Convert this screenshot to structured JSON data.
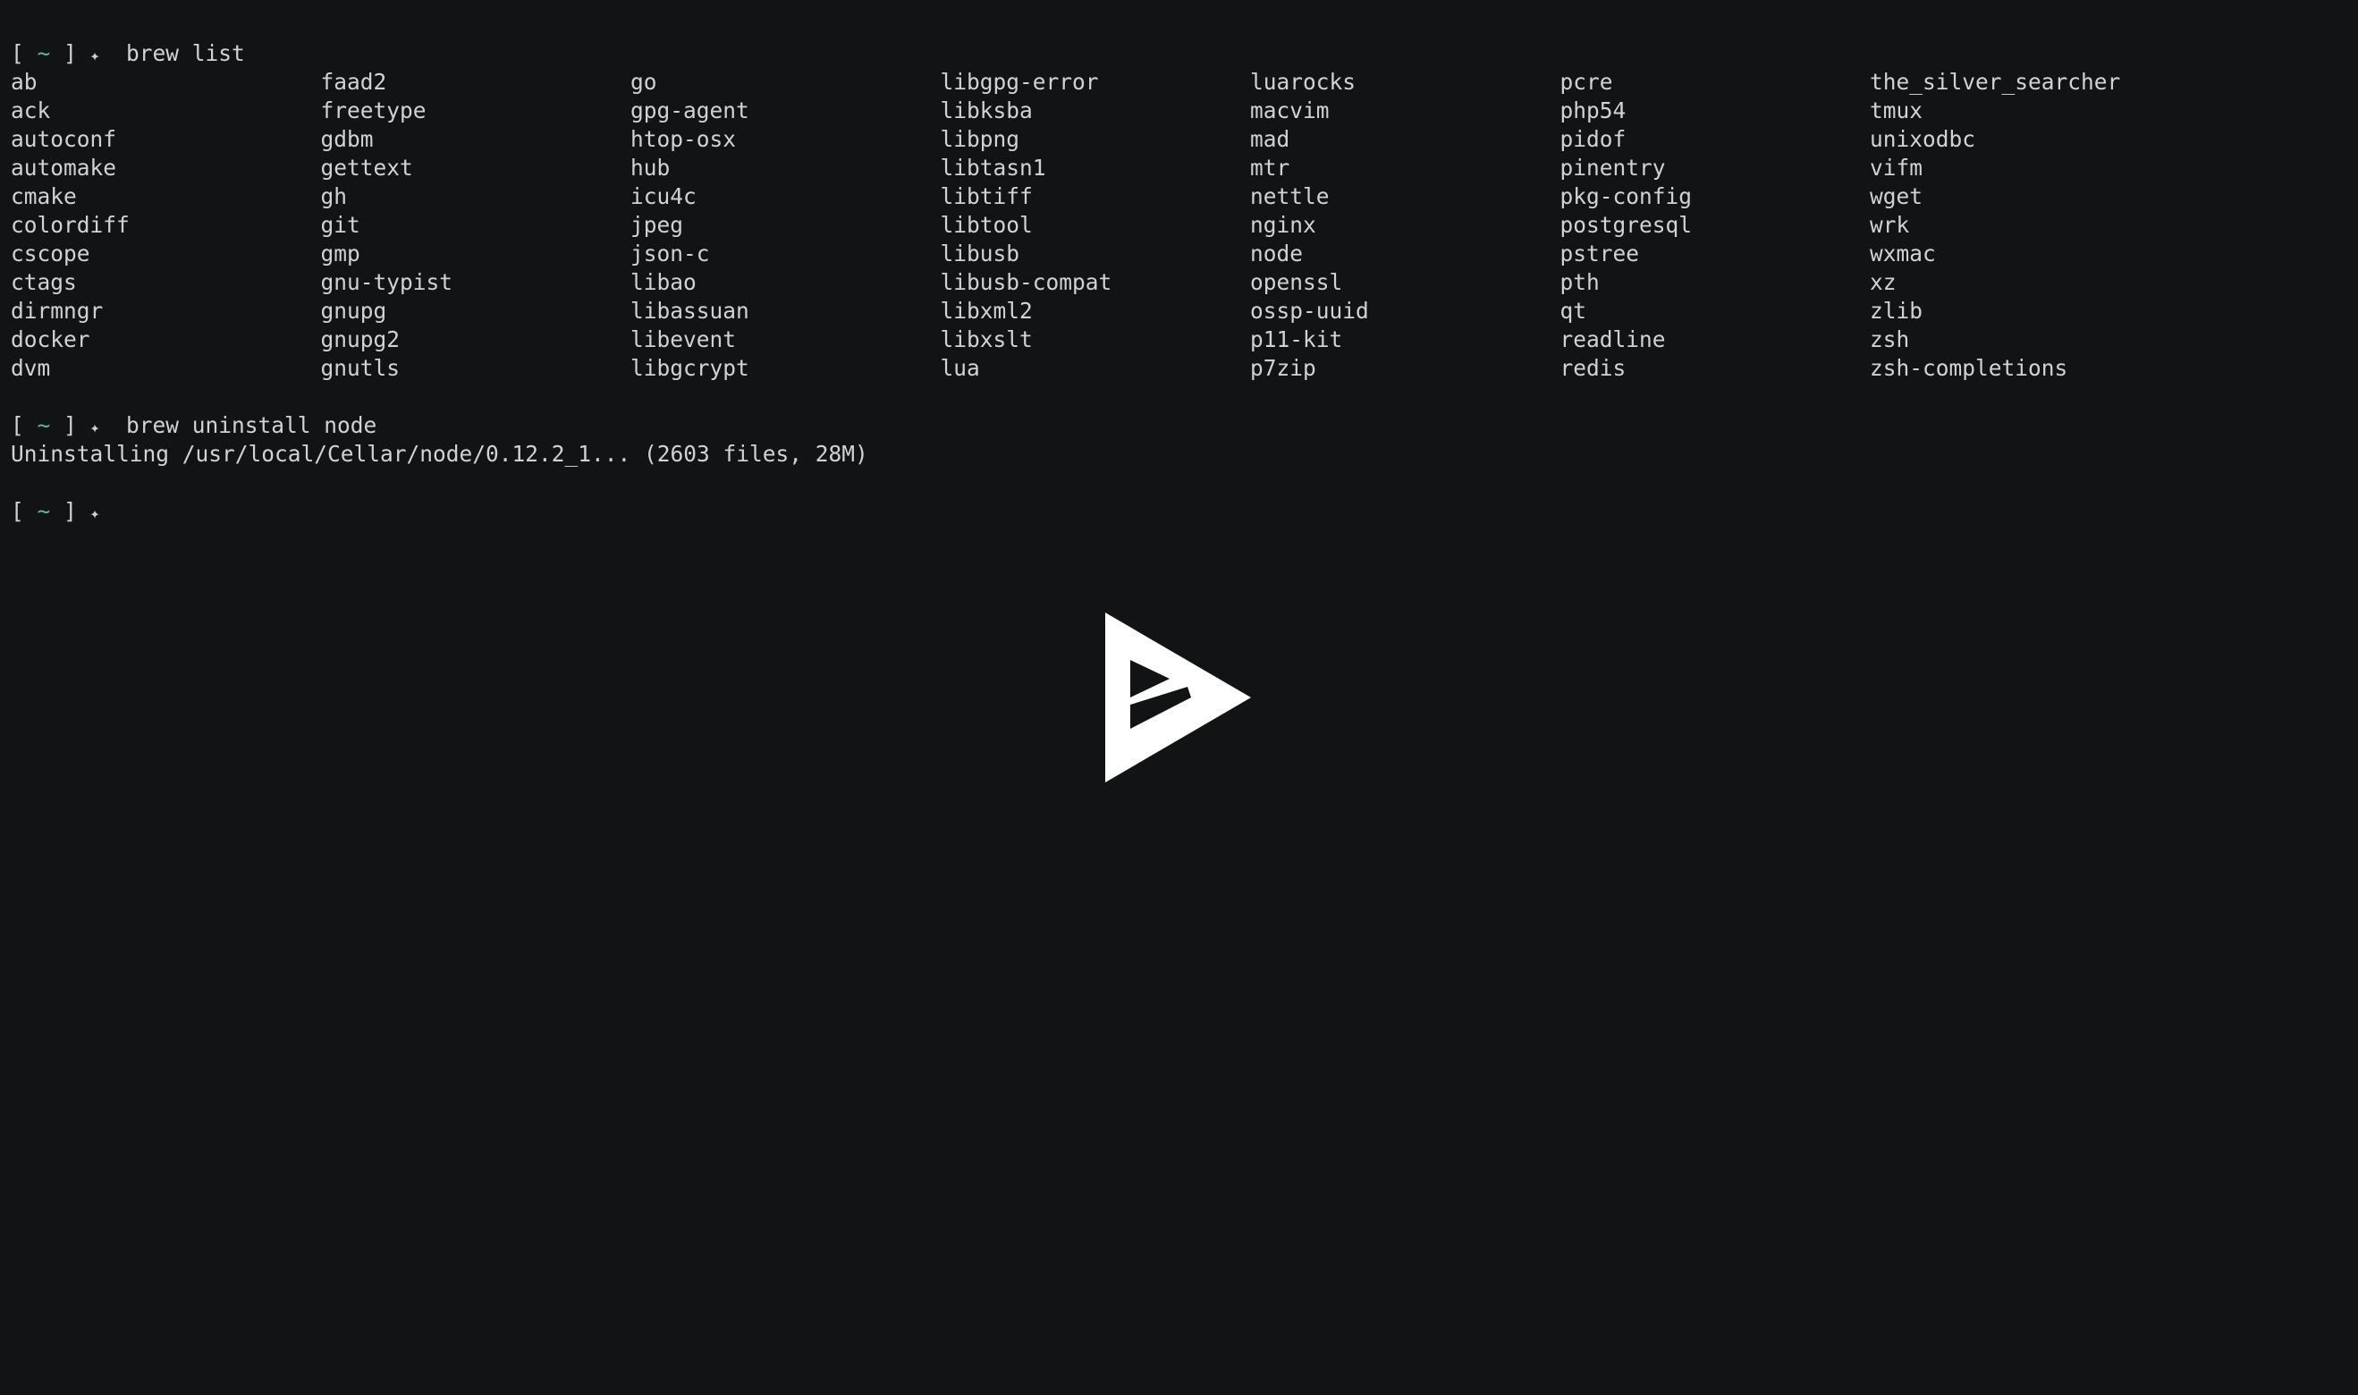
{
  "prompt": {
    "open": "[",
    "home": "~",
    "close": "]",
    "symbol": "✦"
  },
  "session": {
    "cmd1": "brew list",
    "cmd2": "brew uninstall node",
    "output2": "Uninstalling /usr/local/Cellar/node/0.12.2_1... (2603 files, 28M)"
  },
  "brew_list": [
    "ab",
    "ack",
    "autoconf",
    "automake",
    "cmake",
    "colordiff",
    "cscope",
    "ctags",
    "dirmngr",
    "docker",
    "dvm",
    "faad2",
    "freetype",
    "gdbm",
    "gettext",
    "gh",
    "git",
    "gmp",
    "gnu-typist",
    "gnupg",
    "gnupg2",
    "gnutls",
    "go",
    "gpg-agent",
    "htop-osx",
    "hub",
    "icu4c",
    "jpeg",
    "json-c",
    "libao",
    "libassuan",
    "libevent",
    "libgcrypt",
    "libgpg-error",
    "libksba",
    "libpng",
    "libtasn1",
    "libtiff",
    "libtool",
    "libusb",
    "libusb-compat",
    "libxml2",
    "libxslt",
    "lua",
    "luarocks",
    "macvim",
    "mad",
    "mtr",
    "nettle",
    "nginx",
    "node",
    "openssl",
    "ossp-uuid",
    "p11-kit",
    "p7zip",
    "pcre",
    "php54",
    "pidof",
    "pinentry",
    "pkg-config",
    "postgresql",
    "pstree",
    "pth",
    "qt",
    "readline",
    "redis",
    "the_silver_searcher",
    "tmux",
    "unixodbc",
    "vifm",
    "wget",
    "wrk",
    "wxmac",
    "xz",
    "zlib",
    "zsh",
    "zsh-completions"
  ],
  "colors": {
    "background": "#121314",
    "foreground": "#d0d2d4",
    "prompt_tilde": "#5fb7a6",
    "play_icon": "#ffffff"
  },
  "icons": {
    "play": "asciinema-play-logo-icon"
  }
}
